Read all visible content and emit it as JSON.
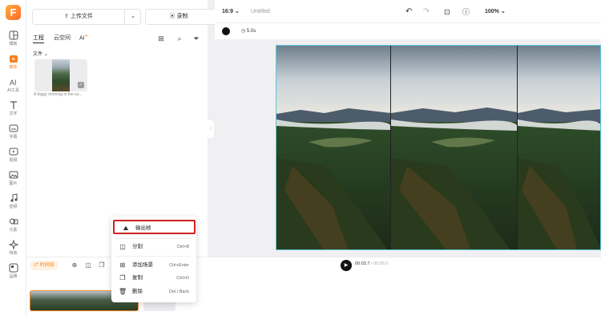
{
  "app": {
    "logo_letter": "F",
    "accent_color": "#f5821f"
  },
  "rail": {
    "items": [
      {
        "label": "模板",
        "icon": "grid-icon"
      },
      {
        "label": "媒体",
        "icon": "media-icon"
      },
      {
        "label": "AI工具",
        "icon": "ai-icon"
      },
      {
        "label": "文字",
        "icon": "text-icon"
      },
      {
        "label": "字幕",
        "icon": "subtitle-icon"
      },
      {
        "label": "视频",
        "icon": "video-icon"
      },
      {
        "label": "图片",
        "icon": "image-icon"
      },
      {
        "label": "音频",
        "icon": "audio-icon"
      },
      {
        "label": "元素",
        "icon": "element-icon"
      },
      {
        "label": "特效",
        "icon": "effect-icon"
      },
      {
        "label": "品牌",
        "icon": "brand-icon"
      }
    ]
  },
  "panel": {
    "upload_label": "上传文件",
    "record_label": "录制",
    "tabs": [
      {
        "label": "工程"
      },
      {
        "label": "云空间"
      },
      {
        "label": "AI"
      }
    ],
    "ai_badge": "✦",
    "section_label": "文件",
    "thumb_caption": "A foggy morning in the su..."
  },
  "topbar": {
    "aspect": "16:9",
    "title": "Untitled",
    "zoom": "100%"
  },
  "stage": {
    "duration": "5.0s"
  },
  "playback": {
    "timeline_label": "时间线",
    "current": "00:03.7",
    "total": "/ 00:05.0"
  },
  "context_menu": {
    "items": [
      {
        "label": "输出帧",
        "shortcut": ""
      },
      {
        "label": "分割",
        "shortcut": "Ctrl+B"
      },
      {
        "label": "添加场景",
        "shortcut": "Ctrl+Enter"
      },
      {
        "label": "复制",
        "shortcut": "Ctrl+D"
      },
      {
        "label": "删除",
        "shortcut": "Del / Back"
      }
    ]
  }
}
